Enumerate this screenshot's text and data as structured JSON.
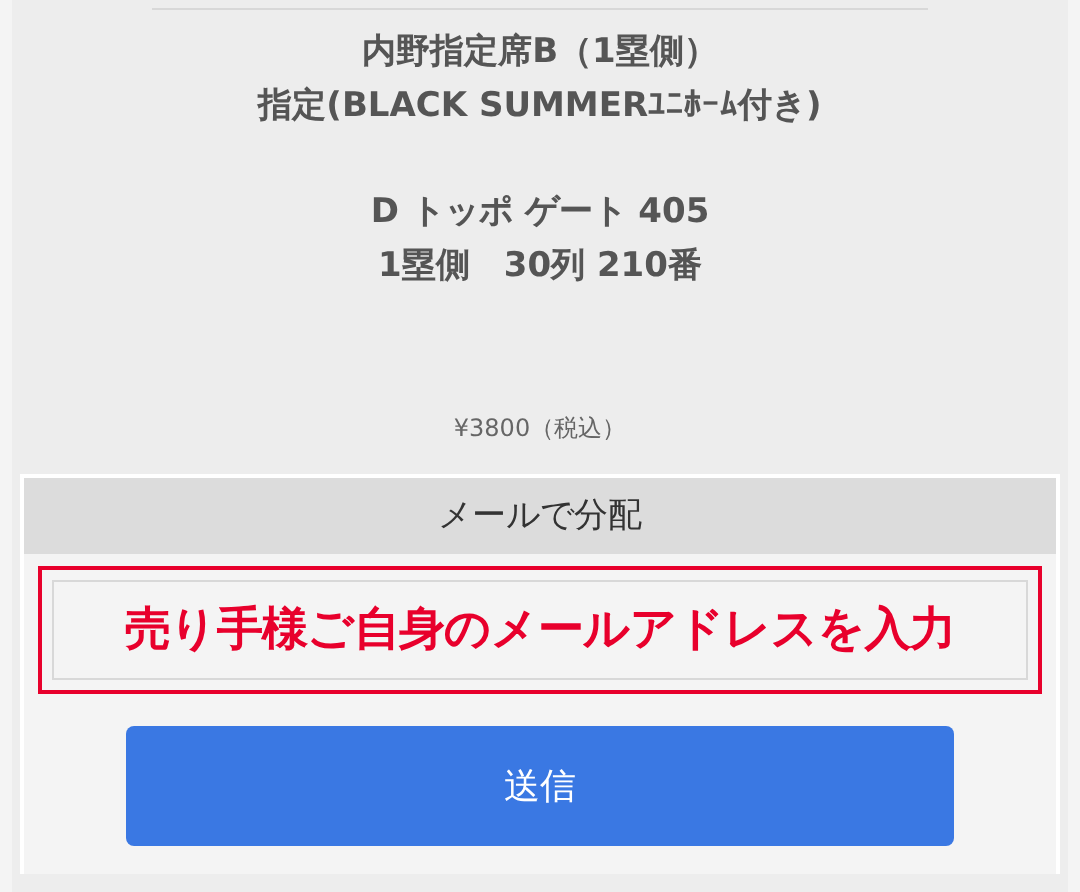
{
  "ticket": {
    "seat_lines": [
      "内野指定席B（1塁側）",
      "指定(BLACK SUMMERﾕﾆﾎｰﾑ付き)"
    ],
    "location_lines": [
      "D トッポ ゲート 405",
      "1塁側　30列 210番"
    ],
    "price": "¥3800（税込）"
  },
  "distribution": {
    "title": "メールで分配",
    "email_field": {
      "annotation": "売り手様ご自身のメールアドレスを入力"
    },
    "submit_button": "送信"
  }
}
